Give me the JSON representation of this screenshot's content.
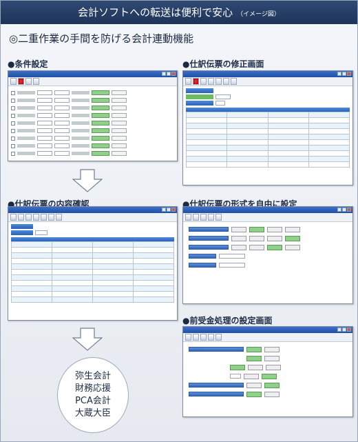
{
  "banner": {
    "title": "会計ソフトへの転送は便利で安心",
    "note": "（イメージ図）"
  },
  "headline": "◎二重作業の手間を防げる会計連動機能",
  "sections": {
    "jouken": "●条件設定",
    "shusei": "●仕訳伝票の修正画面",
    "naiyou": "●仕訳伝票の内容確認",
    "keishiki": "●仕訳伝票の形式を自由に設定",
    "maeuke": "●前受金処理の設定画面"
  },
  "software": [
    "弥生会計",
    "財務応援",
    "PCA会計",
    "大蔵大臣"
  ],
  "colors": {
    "banner": "#2f4a74",
    "titlebar": "#1f4fa6",
    "accent_green": "#8fd18a"
  }
}
